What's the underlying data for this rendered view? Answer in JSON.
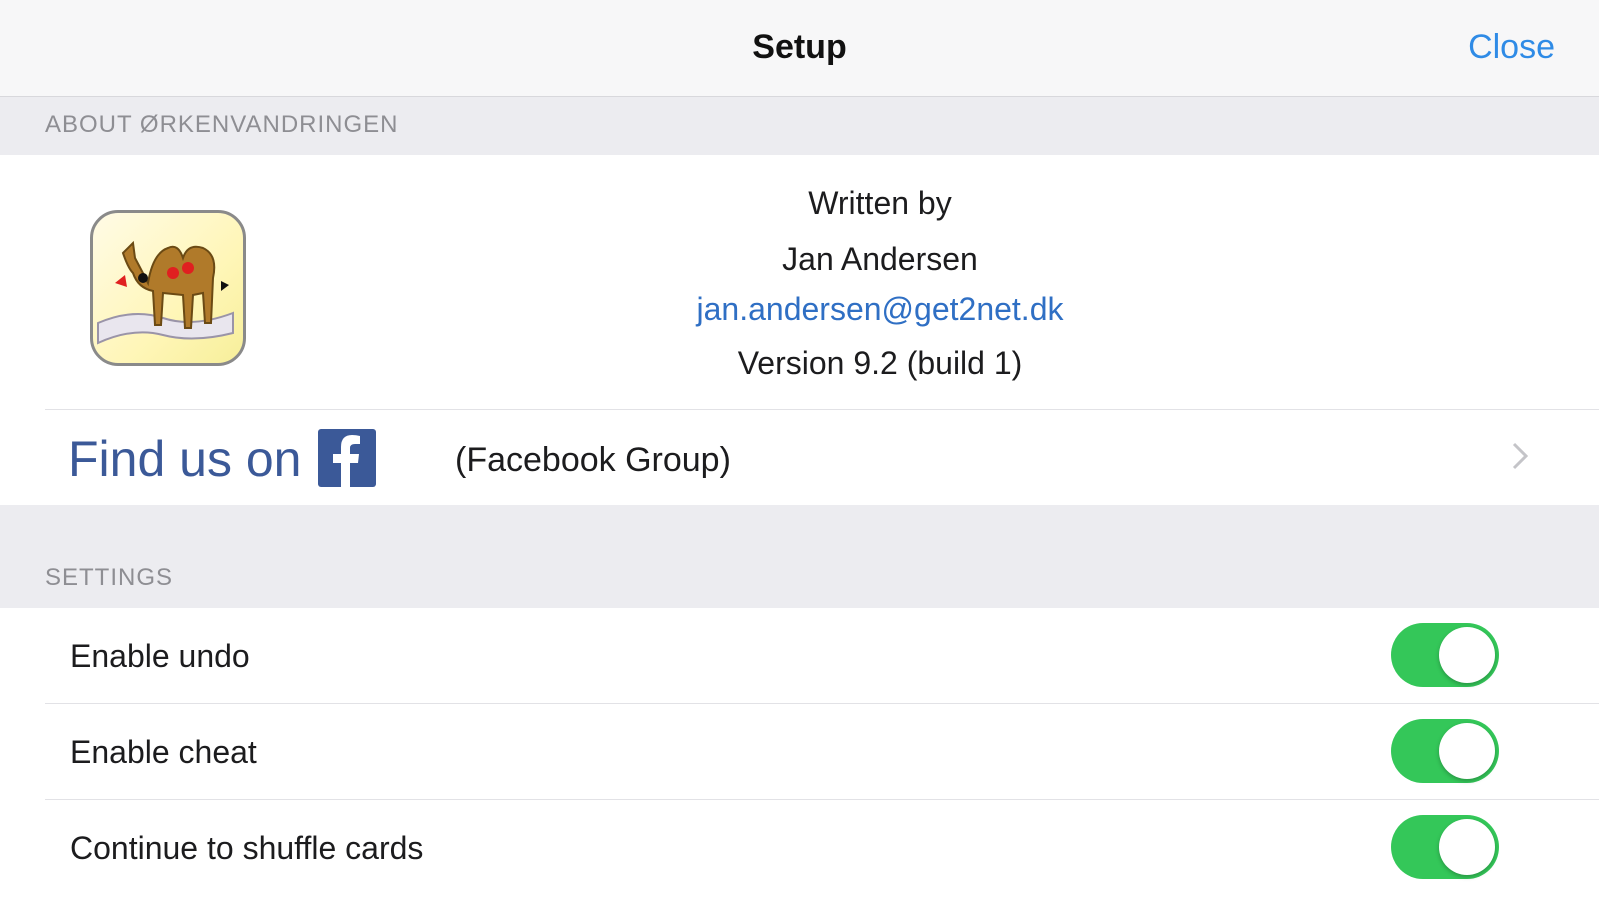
{
  "nav": {
    "title": "Setup",
    "close_label": "Close"
  },
  "about": {
    "section_header": "ABOUT ØRKENVANDRINGEN",
    "app_icon": "camel-app-icon",
    "written_by": "Written by",
    "author": "Jan Andersen",
    "email": "jan.andersen@get2net.dk",
    "version": "Version 9.2 (build 1)"
  },
  "facebook": {
    "find_us_label": "Find us on",
    "logo_icon": "facebook-logo-icon",
    "group_label": "(Facebook Group)",
    "chevron_icon": "chevron-right-icon"
  },
  "settings": {
    "section_header": "SETTINGS",
    "items": [
      {
        "label": "Enable undo",
        "enabled": true
      },
      {
        "label": "Enable cheat",
        "enabled": true
      },
      {
        "label": "Continue to shuffle cards",
        "enabled": true
      }
    ]
  },
  "colors": {
    "accent": "#2f8be6",
    "toggle_on": "#34c759",
    "facebook": "#3b5998",
    "link": "#2f6fc4"
  }
}
